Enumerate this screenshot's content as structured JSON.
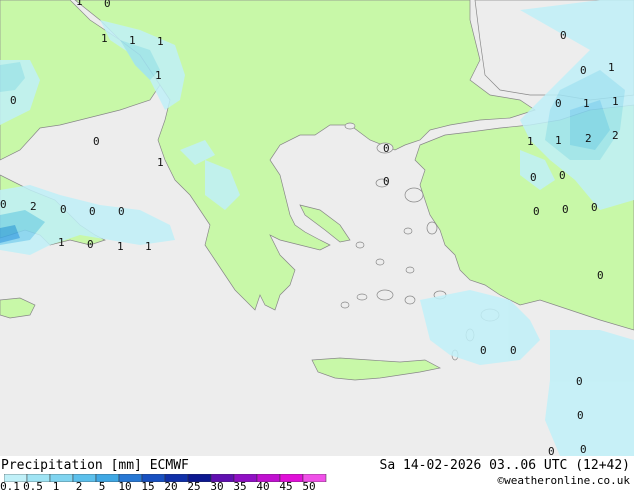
{
  "legend": {
    "title": "Precipitation [mm]",
    "model": "ECMWF",
    "ticks": [
      "0.1",
      "0.5",
      "1",
      "2",
      "5",
      "10",
      "15",
      "20",
      "25",
      "30",
      "35",
      "40",
      "45",
      "50"
    ],
    "colors": [
      "#c0f0f8",
      "#a0e4f4",
      "#80d4f0",
      "#5cc0ec",
      "#40a8e4",
      "#2878d4",
      "#1850c0",
      "#1030a8",
      "#0c1890",
      "#6010b0",
      "#9010c4",
      "#c010d0",
      "#e010d8",
      "#f050e8"
    ]
  },
  "run": {
    "datetime": "Sa 14-02-2026 03..06 UTC (12+42)"
  },
  "credit": "©weatheronline.co.uk",
  "map": {
    "land_color": "#c8f8a8",
    "sea_color": "#ededed",
    "point_values": [
      {
        "id": "p1",
        "text": "0"
      },
      {
        "id": "p2",
        "text": "1"
      },
      {
        "id": "p3",
        "text": "1"
      },
      {
        "id": "p4",
        "text": "1"
      },
      {
        "id": "p5",
        "text": "1"
      },
      {
        "id": "p6",
        "text": "1"
      },
      {
        "id": "p7",
        "text": "0"
      },
      {
        "id": "p8",
        "text": "0"
      },
      {
        "id": "p9",
        "text": "1"
      },
      {
        "id": "p10",
        "text": "0"
      },
      {
        "id": "p11",
        "text": "0"
      },
      {
        "id": "p12",
        "text": "2"
      },
      {
        "id": "p13",
        "text": "0"
      },
      {
        "id": "p14",
        "text": "0"
      },
      {
        "id": "p15",
        "text": "1"
      },
      {
        "id": "p16",
        "text": "0"
      },
      {
        "id": "p17",
        "text": "1"
      },
      {
        "id": "p18",
        "text": "1"
      },
      {
        "id": "p19",
        "text": "0"
      },
      {
        "id": "p20",
        "text": "0"
      },
      {
        "id": "p21",
        "text": "0"
      },
      {
        "id": "p22",
        "text": "1"
      },
      {
        "id": "p23",
        "text": "1"
      },
      {
        "id": "p24",
        "text": "0"
      },
      {
        "id": "p25",
        "text": "1"
      },
      {
        "id": "p26",
        "text": "2"
      },
      {
        "id": "p27",
        "text": "1"
      },
      {
        "id": "p28",
        "text": "1"
      },
      {
        "id": "p29",
        "text": "0"
      },
      {
        "id": "p30",
        "text": "0"
      },
      {
        "id": "p31",
        "text": "0"
      },
      {
        "id": "p32",
        "text": "0"
      },
      {
        "id": "p33",
        "text": "0"
      },
      {
        "id": "p34",
        "text": "0"
      },
      {
        "id": "p35",
        "text": "0"
      },
      {
        "id": "p36",
        "text": "0"
      },
      {
        "id": "p37",
        "text": "0"
      },
      {
        "id": "p38",
        "text": "0"
      },
      {
        "id": "p39",
        "text": "0"
      },
      {
        "id": "p40",
        "text": "0"
      },
      {
        "id": "p41",
        "text": "0"
      },
      {
        "id": "p42",
        "text": "2"
      }
    ]
  }
}
